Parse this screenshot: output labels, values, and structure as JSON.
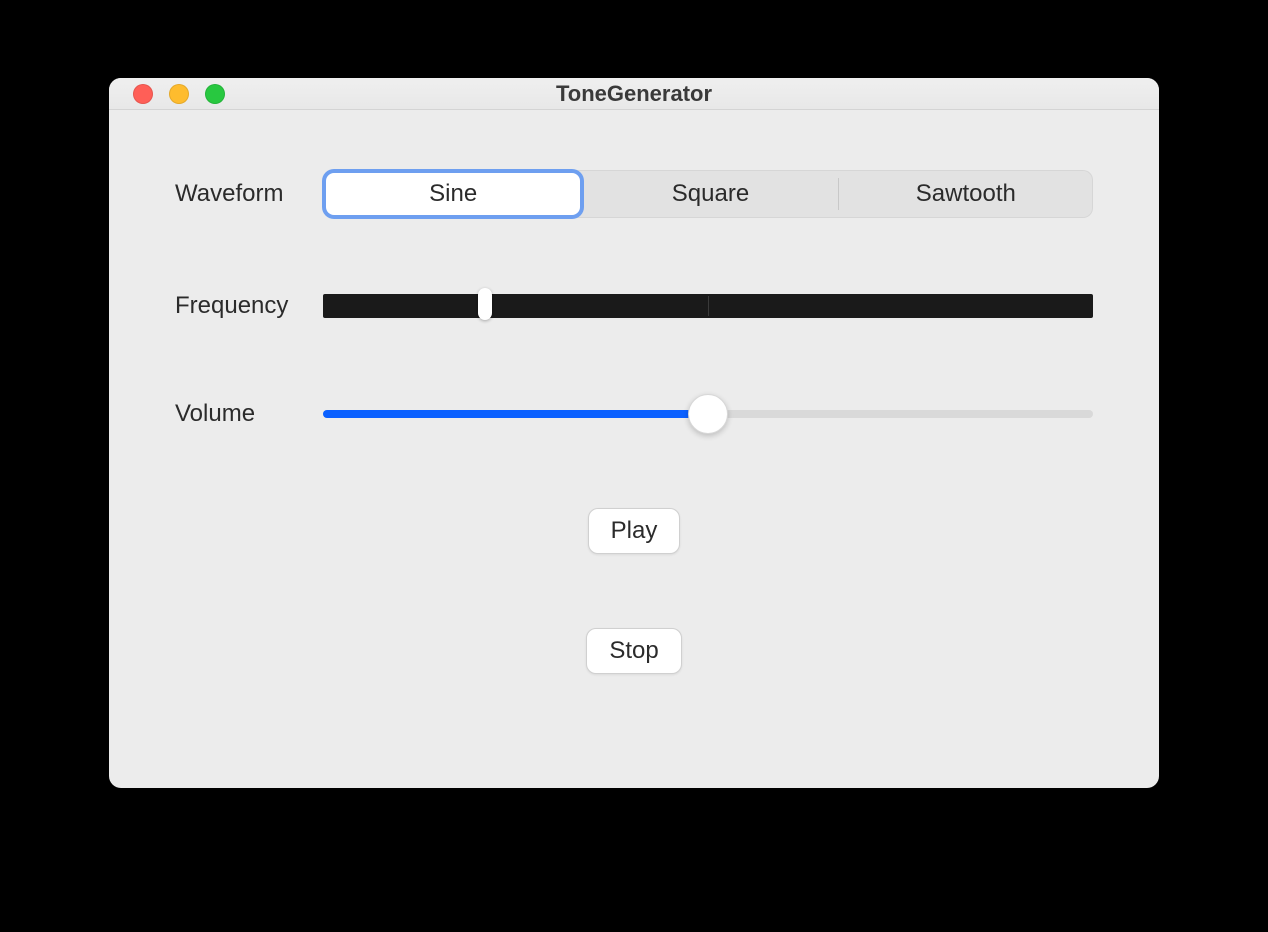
{
  "window": {
    "title": "ToneGenerator"
  },
  "waveform": {
    "label": "Waveform",
    "options": [
      "Sine",
      "Square",
      "Sawtooth"
    ],
    "selected": "Sine"
  },
  "frequency": {
    "label": "Frequency",
    "value_percent": 21
  },
  "volume": {
    "label": "Volume",
    "value_percent": 50
  },
  "buttons": {
    "play": "Play",
    "stop": "Stop"
  },
  "colors": {
    "accent_blue": "#0a60ff",
    "focus_ring": "#6e9ff0",
    "window_bg": "#ececec"
  }
}
